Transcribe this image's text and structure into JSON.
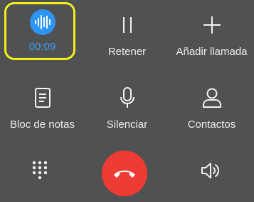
{
  "call_controls": {
    "record": {
      "timer": "00:09",
      "icon": "waveform-icon",
      "accent": "#2f95f2",
      "highlight": "#f5ee1c"
    },
    "hold": {
      "label": "Retener",
      "icon": "pause-icon"
    },
    "add_call": {
      "label": "Añadir llamada",
      "icon": "plus-icon"
    },
    "notes": {
      "label": "Bloc de notas",
      "icon": "notepad-icon"
    },
    "mute": {
      "label": "Silenciar",
      "icon": "microphone-icon"
    },
    "contacts": {
      "label": "Contactos",
      "icon": "person-icon"
    }
  },
  "bottom_bar": {
    "keypad": {
      "icon": "dialpad-icon"
    },
    "end_call": {
      "icon": "hang-up-icon",
      "color": "#ee3b33"
    },
    "speaker": {
      "icon": "speaker-icon"
    }
  }
}
